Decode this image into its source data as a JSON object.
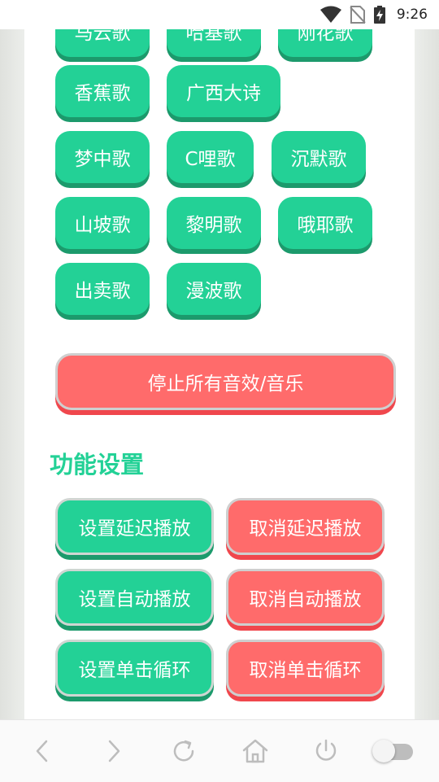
{
  "status_bar": {
    "time": "9:26",
    "icons": [
      "wifi-icon",
      "no-sim-icon",
      "battery-charging-icon"
    ]
  },
  "song_buttons": [
    {
      "label": "马云歌"
    },
    {
      "label": "哈基歌"
    },
    {
      "label": "刚花歌"
    },
    {
      "label": "香蕉歌"
    },
    {
      "label": "广西大诗"
    },
    {
      "label": "梦中歌"
    },
    {
      "label": "C哩歌"
    },
    {
      "label": "沉默歌"
    },
    {
      "label": "山坡歌"
    },
    {
      "label": "黎明歌"
    },
    {
      "label": "哦耶歌"
    },
    {
      "label": "出卖歌"
    },
    {
      "label": "漫波歌"
    }
  ],
  "stop_all_label": "停止所有音效/音乐",
  "section_title": "功能设置",
  "settings": {
    "set_delay": "设置延迟播放",
    "cancel_delay": "取消延迟播放",
    "set_auto": "设置自动播放",
    "cancel_auto": "取消自动播放",
    "set_loop": "设置单击循环",
    "cancel_loop": "取消单击循环"
  },
  "nav_bar": {
    "icons": [
      "back-icon",
      "forward-icon",
      "refresh-icon",
      "home-icon",
      "power-icon",
      "toggle-switch"
    ],
    "toggle_on": false
  },
  "colors": {
    "green": "#23d196",
    "green_shadow": "#1c9a6c",
    "red": "#ff6b6b",
    "red_shadow": "#f0474d"
  }
}
